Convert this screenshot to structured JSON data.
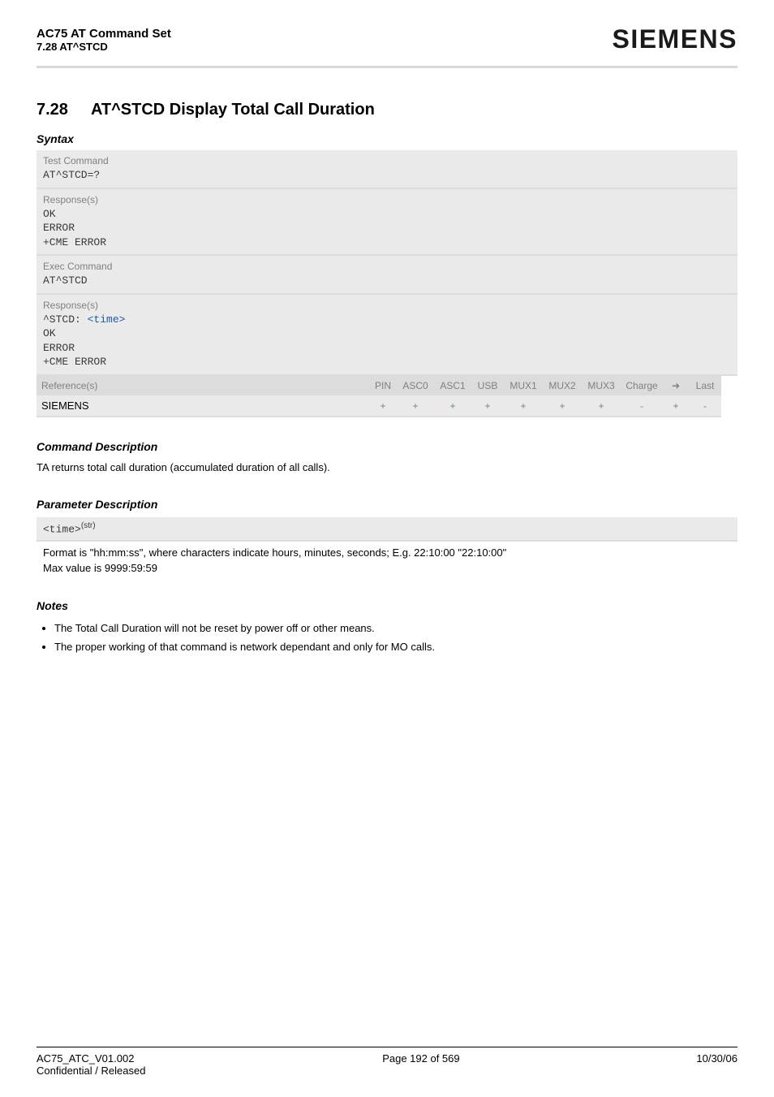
{
  "header": {
    "doc_title": "AC75 AT Command Set",
    "doc_sub": "7.28 AT^STCD",
    "logo": "SIEMENS"
  },
  "section": {
    "number": "7.28",
    "title": "AT^STCD   Display Total Call Duration"
  },
  "syntax_title": "Syntax",
  "test_command": {
    "label": "Test Command",
    "cmd": "AT^STCD=?",
    "response_label": "Response(s)",
    "lines": [
      "OK",
      "ERROR",
      "+CME ERROR"
    ]
  },
  "exec_command": {
    "label": "Exec Command",
    "cmd": "AT^STCD",
    "response_label": "Response(s)",
    "prefix": "^STCD: ",
    "time_ref": "<time>",
    "lines_after": [
      "OK",
      "ERROR",
      "+CME ERROR"
    ]
  },
  "ref_table": {
    "headers": [
      "Reference(s)",
      "PIN",
      "ASC0",
      "ASC1",
      "USB",
      "MUX1",
      "MUX2",
      "MUX3",
      "Charge",
      "➜",
      "Last"
    ],
    "row": [
      "SIEMENS",
      "+",
      "+",
      "+",
      "+",
      "+",
      "+",
      "+",
      "-",
      "+",
      "-"
    ]
  },
  "command_desc": {
    "title": "Command Description",
    "text": "TA returns total call duration (accumulated duration of all calls)."
  },
  "param_desc": {
    "title": "Parameter Description",
    "param_name": "<time>",
    "param_sup": "(str)",
    "lines": [
      "Format is \"hh:mm:ss\", where characters indicate hours, minutes, seconds; E.g. 22:10:00 \"22:10:00\"",
      "Max value is 9999:59:59"
    ]
  },
  "notes": {
    "title": "Notes",
    "items": [
      "The Total Call Duration will not be reset by power off or other means.",
      "The proper working of that command is network dependant and only for MO calls."
    ]
  },
  "footer": {
    "left_line1": "AC75_ATC_V01.002",
    "left_line2": "Confidential / Released",
    "center": "Page 192 of 569",
    "right": "10/30/06"
  }
}
